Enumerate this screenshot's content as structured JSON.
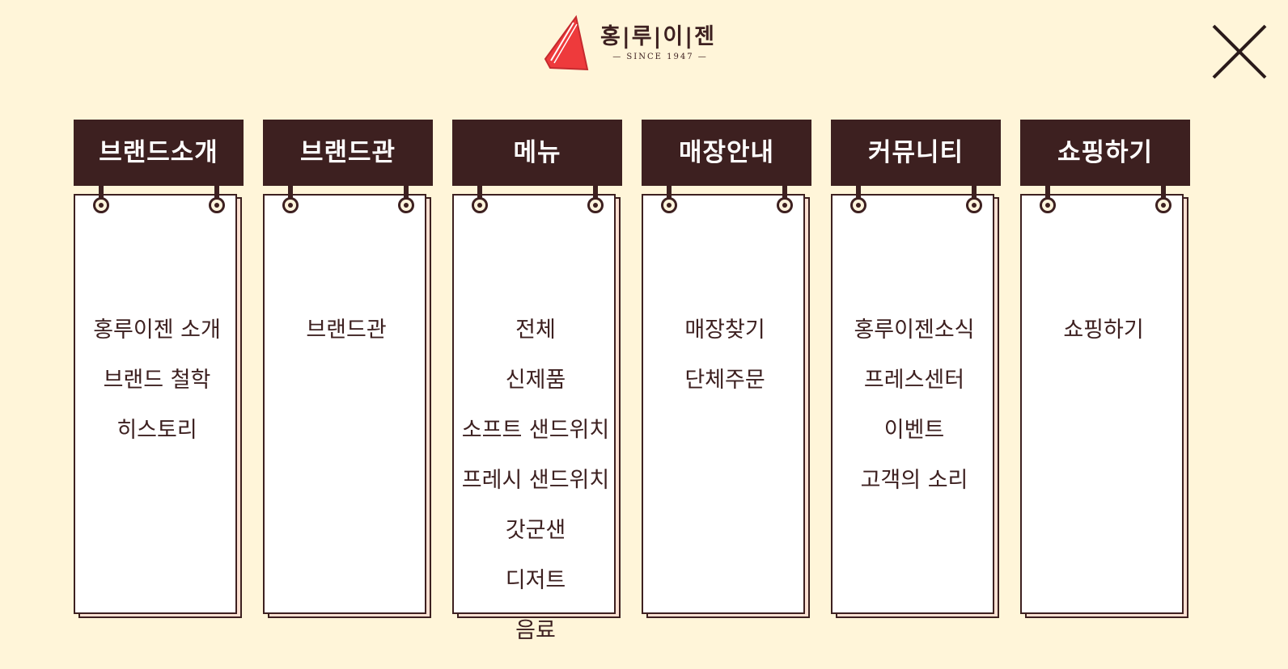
{
  "logo": {
    "name": "홍|루|이|젠",
    "since": "— SINCE 1947 —",
    "brand_color": "#ee3a3c"
  },
  "close_icon": "close-icon",
  "colors": {
    "background": "#fff5d9",
    "header": "#3d2020",
    "paper": "#ffffff",
    "paper_shadow": "#fde0d2"
  },
  "columns": [
    {
      "title": "브랜드소개",
      "items": [
        "홍루이젠 소개",
        "브랜드 철학",
        "히스토리"
      ]
    },
    {
      "title": "브랜드관",
      "items": [
        "브랜드관"
      ]
    },
    {
      "title": "메뉴",
      "items": [
        "전체",
        "신제품",
        "소프트 샌드위치",
        "프레시 샌드위치",
        "갓군샌",
        "디저트",
        "음료"
      ]
    },
    {
      "title": "매장안내",
      "items": [
        "매장찾기",
        "단체주문"
      ]
    },
    {
      "title": "커뮤니티",
      "items": [
        "홍루이젠소식",
        "프레스센터",
        "이벤트",
        "고객의 소리"
      ]
    },
    {
      "title": "쇼핑하기",
      "items": [
        "쇼핑하기"
      ]
    }
  ]
}
